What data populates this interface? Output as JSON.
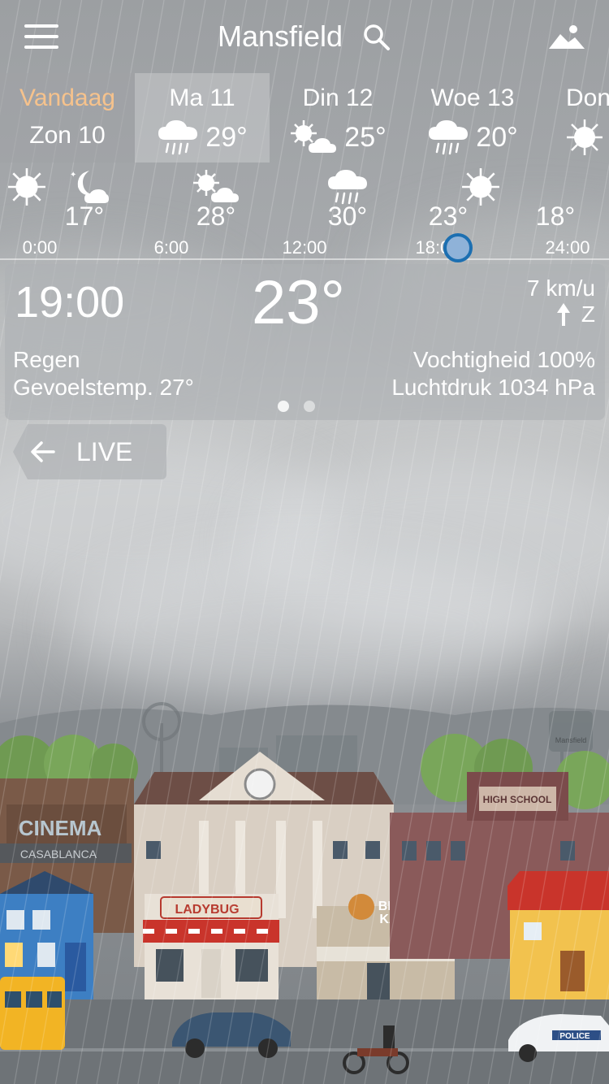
{
  "header": {
    "city": "Mansfield",
    "icons": [
      "menu-icon",
      "search-icon",
      "landscape-icon"
    ]
  },
  "days": [
    {
      "label": "Vandaag",
      "sub": "Zon 10"
    },
    {
      "label": "Ma 11",
      "icon": "rain-icon",
      "temp": "29°"
    },
    {
      "label": "Din 12",
      "icon": "sun-cloud-icon",
      "temp": "25°"
    },
    {
      "label": "Woe 13",
      "icon": "rain-icon",
      "temp": "20°"
    },
    {
      "label": "Don",
      "icon": "sun-icon"
    }
  ],
  "hourly": {
    "temps": [
      "17°",
      "28°",
      "30°",
      "23°",
      "18°"
    ],
    "times": [
      "0:00",
      "6:00",
      "12:00",
      "18:00",
      "24:00"
    ],
    "icons": [
      "sun-icon",
      "moon-cloud-icon",
      "sun-cloud-icon",
      "rain-icon",
      "sun-icon"
    ]
  },
  "detail": {
    "time": "19:00",
    "temp": "23°",
    "wind": "7 km/u",
    "wind_dir": "Z",
    "condition": "Regen",
    "feels": "Gevoelstemp. 27°",
    "humidity": "Vochtigheid 100%",
    "pressure": "Luchtdruk 1034 hPa"
  },
  "live": {
    "label": "LIVE"
  },
  "scene": {
    "signs": [
      "CINEMA",
      "CASABLANCA",
      "LADYBUG",
      "BIG",
      "KAHUNA",
      "HIGH SCHOOL",
      "POLICE",
      "Mansfield"
    ]
  },
  "colors": {
    "today_label": "#f6c28c",
    "knob_border": "#1c6fb1",
    "knob_fill": "#8fb2d8"
  }
}
